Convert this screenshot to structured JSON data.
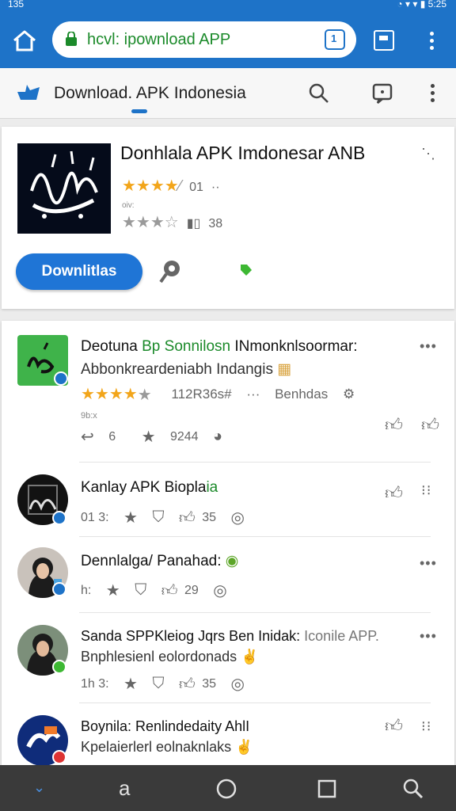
{
  "status_bar": {
    "time_left": "135",
    "time_right": "5:25"
  },
  "browser": {
    "url": "hcvl: ipownload APP",
    "tab_count": "1"
  },
  "app_bar": {
    "title": "Download. APK Indonesia"
  },
  "featured": {
    "title": "Donhlala APK Imdonesar ANB",
    "rating_text": "01",
    "small_text": "oiv:",
    "rating_count": "38",
    "download_label": "Downlitlas"
  },
  "items": [
    {
      "title_black": "Deotuna ",
      "title_green": "Bp Sonnilosn",
      "title_rest": " INmonknlsoormar:",
      "subtitle": "Abbonkreardeniabh Indangis",
      "rating_meta": "112R36s#",
      "rating_extra": "Benhdas",
      "small": "9b:x",
      "action_a": "6",
      "action_b": "9244"
    },
    {
      "title": "Kanlay APK Biopla",
      "title_green": "ia",
      "action_a": "01 3:",
      "action_b": "35"
    },
    {
      "title": "Dennlalga/ Panahad:",
      "action_a": "h:",
      "action_b": "29"
    },
    {
      "title": "Sanda SPPKleiog Jqrs Ben Inidak:",
      "title_grey": " Iconile APP.",
      "subtitle": "Bnphlesienl eolordonads",
      "action_a": "1h 3:",
      "action_b": "35"
    },
    {
      "title": "Boynila: Renlindedaity AhlI",
      "subtitle": "Kpelaierlerl eolnaknlaks"
    }
  ],
  "colors": {
    "primary": "#1e73c8",
    "button": "#1f75d6",
    "url_green": "#1b8a2a",
    "star": "#f2a51a"
  }
}
